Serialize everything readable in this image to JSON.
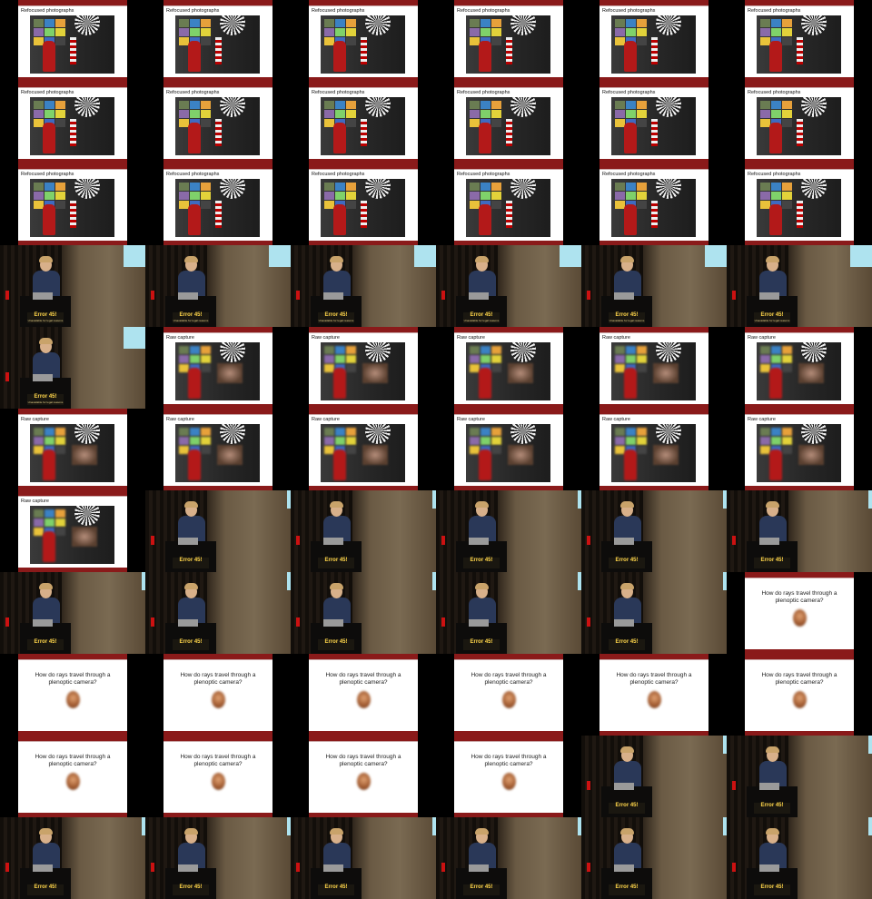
{
  "sheet": {
    "columns": 6,
    "rows": 11
  },
  "colors": {
    "slide_bar": "#8a1a1a",
    "screen": "#aee3ef",
    "sign_text": "#ffd64a"
  },
  "texts": {
    "refocused": "Refocused photographs",
    "raw": "Raw capture",
    "question": "How do rays travel through a plenoptic camera?",
    "error": "Error 45!",
    "error_sub": "Unavailable for legal reasons"
  },
  "frames": [
    "refocused",
    "refocused",
    "refocused",
    "refocused",
    "refocused",
    "refocused",
    "refocused",
    "refocused",
    "refocused",
    "refocused",
    "refocused",
    "refocused",
    "refocused",
    "refocused",
    "refocused",
    "refocused",
    "refocused",
    "refocused",
    "stage-screen",
    "stage-screen",
    "stage-screen",
    "stage-screen",
    "stage-screen",
    "stage-screen",
    "stage-screen",
    "raw",
    "raw",
    "raw",
    "raw",
    "raw",
    "raw",
    "raw",
    "raw",
    "raw",
    "raw",
    "raw",
    "raw",
    "stage",
    "stage",
    "stage",
    "stage",
    "stage",
    "stage",
    "stage",
    "stage",
    "stage",
    "stage",
    "question",
    "question",
    "question",
    "question",
    "question",
    "question",
    "question",
    "question",
    "question",
    "question",
    "question",
    "stage",
    "stage",
    "stage",
    "stage",
    "stage",
    "stage",
    "stage",
    "stage"
  ]
}
